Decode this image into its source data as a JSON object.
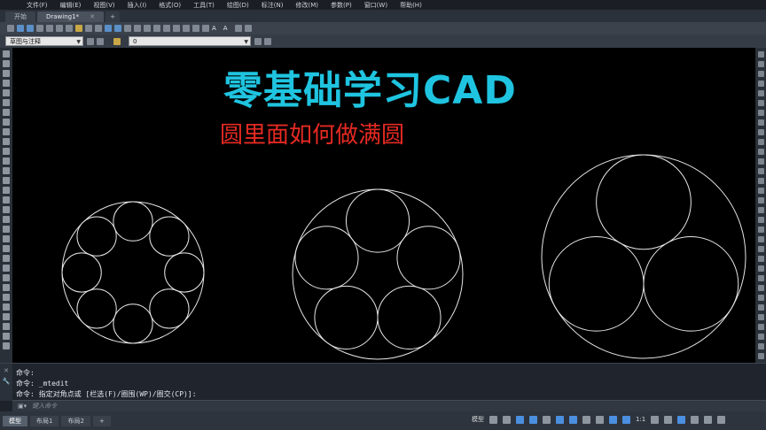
{
  "menu": [
    "文件(F)",
    "编辑(E)",
    "视图(V)",
    "插入(I)",
    "格式(O)",
    "工具(T)",
    "绘图(D)",
    "标注(N)",
    "修改(M)",
    "参数(P)",
    "窗口(W)",
    "帮助(H)"
  ],
  "tabs": {
    "start": "开始",
    "drawing": "Drawing1*",
    "close": "✕",
    "new": "+"
  },
  "toolbar": {
    "text_style_glyph": "A",
    "layer_name": "0"
  },
  "workspace": {
    "name": "草图与注释"
  },
  "canvas": {
    "title": "零基础学习CAD",
    "subtitle": "圆里面如何做满圆",
    "title_color": "#1fc4e0",
    "subtitle_color": "#e52a22",
    "line_color": "#e6e6e6"
  },
  "drawing": {
    "examples": [
      {
        "inner_circle_count": 8
      },
      {
        "inner_circle_count": 5
      },
      {
        "inner_circle_count": 3
      }
    ]
  },
  "command": {
    "lines": [
      "命令:",
      "命令:  _mtedit",
      "命令: 指定对角点或 [栏选(F)/圈围(WP)/圈交(CP)]:"
    ],
    "placeholder": "键入命令",
    "side_glyphs": [
      "✕",
      "🔧"
    ]
  },
  "status": {
    "tabs": [
      "模型",
      "布局1",
      "布局2"
    ],
    "model_label": "模型",
    "scale": "1:1"
  }
}
